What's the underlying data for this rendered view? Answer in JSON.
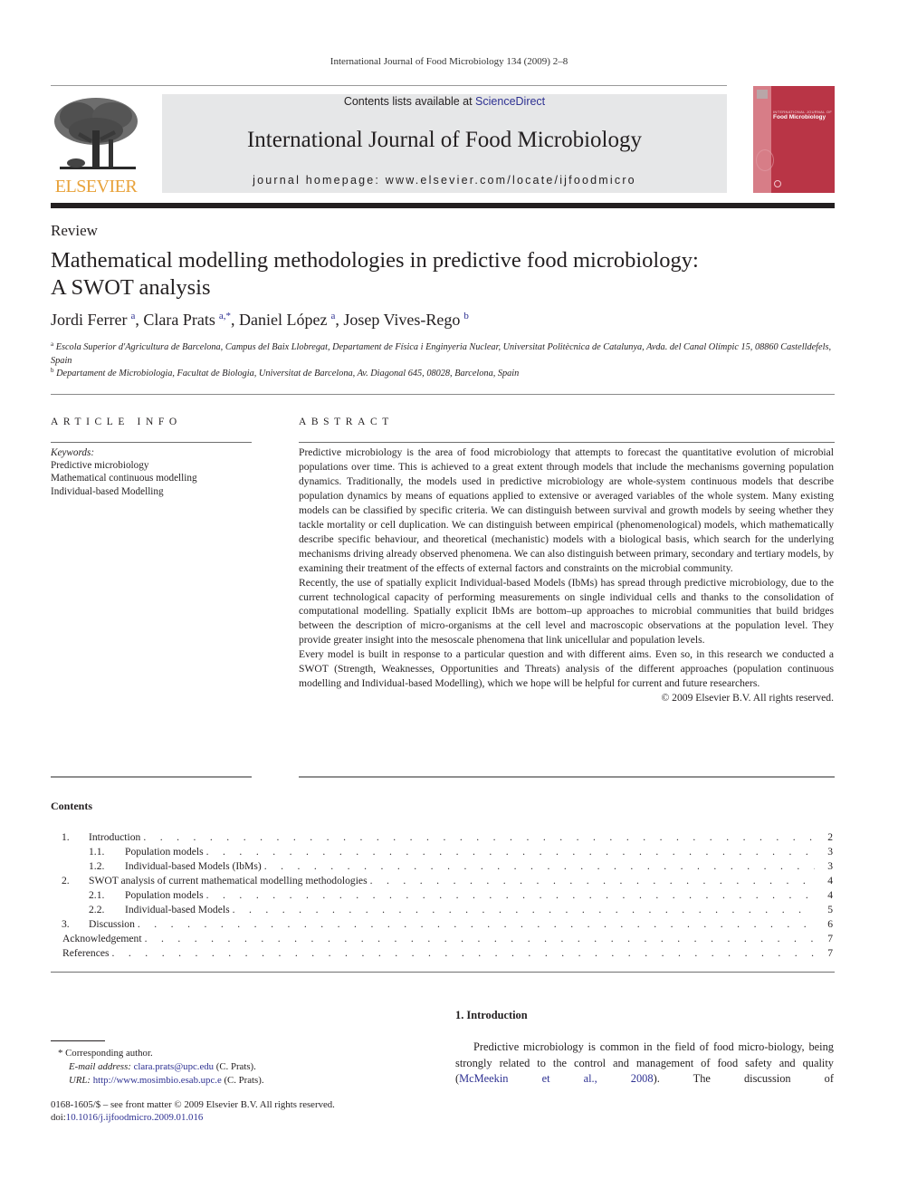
{
  "running_head": "International Journal of Food Microbiology 134 (2009) 2–8",
  "masthead": {
    "publisher_logo": "tree-engraving-icon",
    "publisher_name": "ELSEVIER",
    "contents_prefix": "Contents lists available at ",
    "contents_link": "ScienceDirect",
    "journal_title": "International Journal of Food Microbiology",
    "homepage": "journal homepage: www.elsevier.com/locate/ijfoodmicro",
    "cover": {
      "small_caption": "INTERNATIONAL JOURNAL OF",
      "title": "Food Microbiology",
      "color": "#b93546"
    }
  },
  "article": {
    "type": "Review",
    "title_line1": "Mathematical modelling methodologies in predictive food microbiology:",
    "title_line2": "A SWOT analysis",
    "authors": [
      {
        "name": "Jordi Ferrer",
        "sup": "a",
        "sep": ", "
      },
      {
        "name": "Clara Prats",
        "sup": "a,*",
        "sep": ", "
      },
      {
        "name": "Daniel López",
        "sup": "a",
        "sep": ", "
      },
      {
        "name": "Josep Vives-Rego",
        "sup": "b",
        "sep": ""
      }
    ],
    "affiliations": [
      {
        "mark": "a",
        "text": "Escola Superior d'Agricultura de Barcelona, Campus del Baix Llobregat, Departament de Física i Enginyeria Nuclear, Universitat Politècnica de Catalunya, Avda. del Canal Olímpic 15, 08860 Castelldefels, Spain"
      },
      {
        "mark": "b",
        "text": "Departament de Microbiologia, Facultat de Biologia, Universitat de Barcelona, Av. Diagonal 645, 08028, Barcelona, Spain"
      }
    ]
  },
  "article_info": {
    "heading": "ARTICLE INFO",
    "keywords_label": "Keywords:",
    "keywords": [
      "Predictive microbiology",
      "Mathematical continuous modelling",
      "Individual-based Modelling"
    ]
  },
  "abstract": {
    "heading": "ABSTRACT",
    "paragraphs": [
      "Predictive microbiology is the area of food microbiology that attempts to forecast the quantitative evolution of microbial populations over time. This is achieved to a great extent through models that include the mechanisms governing population dynamics. Traditionally, the models used in predictive microbiology are whole-system continuous models that describe population dynamics by means of equations applied to extensive or averaged variables of the whole system. Many existing models can be classified by specific criteria. We can distinguish between survival and growth models by seeing whether they tackle mortality or cell duplication. We can distinguish between empirical (phenomenological) models, which mathematically describe specific behaviour, and theoretical (mechanistic) models with a biological basis, which search for the underlying mechanisms driving already observed phenomena. We can also distinguish between primary, secondary and tertiary models, by examining their treatment of the effects of external factors and constraints on the microbial community.",
      "Recently, the use of spatially explicit Individual-based Models (IbMs) has spread through predictive microbiology, due to the current technological capacity of performing measurements on single individual cells and thanks to the consolidation of computational modelling. Spatially explicit IbMs are bottom–up approaches to microbial communities that build bridges between the description of micro-organisms at the cell level and macroscopic observations at the population level. They provide greater insight into the mesoscale phenomena that link unicellular and population levels.",
      "Every model is built in response to a particular question and with different aims. Even so, in this research we conducted a SWOT (Strength, Weaknesses, Opportunities and Threats) analysis of the different approaches (population continuous modelling and Individual-based Modelling), which we hope will be helpful for current and future researchers."
    ],
    "copyright": "© 2009 Elsevier B.V. All rights reserved."
  },
  "contents": {
    "heading": "Contents",
    "items": [
      {
        "level": 1,
        "num": "1.",
        "title": "Introduction",
        "page": "2"
      },
      {
        "level": 2,
        "num": "1.1.",
        "title": "Population models",
        "page": "3"
      },
      {
        "level": 2,
        "num": "1.2.",
        "title": "Individual-based Models (IbMs)",
        "page": "3"
      },
      {
        "level": 1,
        "num": "2.",
        "title": "SWOT analysis of current mathematical modelling methodologies",
        "page": "4"
      },
      {
        "level": 2,
        "num": "2.1.",
        "title": "Population models",
        "page": "4"
      },
      {
        "level": 2,
        "num": "2.2.",
        "title": "Individual-based Models",
        "page": "5"
      },
      {
        "level": 1,
        "num": "3.",
        "title": "Discussion",
        "page": "6"
      },
      {
        "level": 0,
        "num": "",
        "title": "Acknowledgement",
        "page": "7"
      },
      {
        "level": 0,
        "num": "",
        "title": "References",
        "page": "7"
      }
    ]
  },
  "footnotes": {
    "corresponding": "* Corresponding author.",
    "email_label": "E-mail address:",
    "email": "clara.prats@upc.edu",
    "email_suffix": " (C. Prats).",
    "url_label": "URL:",
    "url": "http://www.mosimbio.esab.upc.e",
    "url_suffix": " (C. Prats).",
    "front_matter": "0168-1605/$ – see front matter © 2009 Elsevier B.V. All rights reserved.",
    "doi_prefix": "doi:",
    "doi": "10.1016/j.ijfoodmicro.2009.01.016"
  },
  "introduction": {
    "heading": "1. Introduction",
    "text_before_cite": "Predictive microbiology is common in the field of food micro-biology, being strongly related to the control and management of food safety and quality (",
    "citation": "McMeekin et al., 2008",
    "text_after_cite": "). The discussion of"
  }
}
